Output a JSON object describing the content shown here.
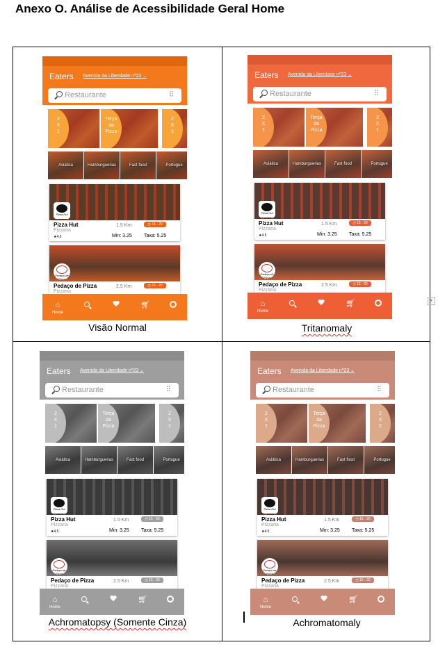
{
  "doc": {
    "title": "Anexo O. Análise de Acessibilidade Geral Home"
  },
  "common": {
    "brand": "Eaters",
    "address": "Avenida da Liberdade nº23",
    "search_placeholder": "Restaurante",
    "promos": [
      "2\nX\n1",
      "Terça\nda\nPizza",
      "2\nX\n1"
    ],
    "categories": [
      "Asiática",
      "Hamburguerias",
      "Fast food",
      "Portugue"
    ],
    "restaurants": [
      {
        "name": "Pizza Hut",
        "cuisine": "Pizzaria",
        "distance": "1.5 Km",
        "time": "15 - 20",
        "rating": "4.5",
        "min": "Min: 3.25",
        "fee": "Taxa: 5.25",
        "logo_text": "Pizza Hut"
      },
      {
        "name": "Pedaço de Pizza",
        "cuisine": "Pizzaria",
        "distance": "2.5 Km",
        "time": "15 - 20",
        "logo_text": "Pedaço de Pizza"
      }
    ],
    "nav": [
      {
        "icon": "home-icon",
        "label": "Home"
      },
      {
        "icon": "search-icon",
        "label": ""
      },
      {
        "icon": "heart-icon",
        "label": ""
      },
      {
        "icon": "cart-icon",
        "label": ""
      },
      {
        "icon": "user-icon",
        "label": ""
      }
    ]
  },
  "panels": [
    {
      "caption": "Visão Normal",
      "misspelled": false,
      "colors": {
        "bar": "#f4791c",
        "strip": "#d9640f",
        "promo": "#f7a43a",
        "nav": "#f4791c",
        "time": "#e8641a",
        "food": "#a43a22",
        "food2": "#c15a2a",
        "room": "#5b3a26",
        "room2": "#c44b2a"
      }
    },
    {
      "caption": "Tritanomaly",
      "misspelled": true,
      "colors": {
        "bar": "#f0683e",
        "strip": "#d9572f",
        "promo": "#f6944a",
        "nav": "#ef5f35",
        "time": "#e85e3a",
        "food": "#a4402c",
        "food2": "#c0623a",
        "room": "#5a3a30",
        "room2": "#c4512f"
      }
    },
    {
      "caption": "Achromatopsy (Somente Cinza)",
      "misspelled": true,
      "colors": {
        "bar": "#9e9e9e",
        "strip": "#8a8a8a",
        "promo": "#bdbdbd",
        "nav": "#9e9e9e",
        "time": "#a0a0a0",
        "food": "#555555",
        "food2": "#7a7a7a",
        "room": "#3a3a3a",
        "room2": "#6e6e6e"
      }
    },
    {
      "caption": "Achromatomaly",
      "misspelled": false,
      "colors": {
        "bar": "#c98b78",
        "strip": "#b47a68",
        "promo": "#dcaa8a",
        "nav": "#c98b78",
        "time": "#c48070",
        "food": "#7c4a3e",
        "food2": "#a06a56",
        "room": "#4a3630",
        "room2": "#a06a56"
      }
    }
  ]
}
